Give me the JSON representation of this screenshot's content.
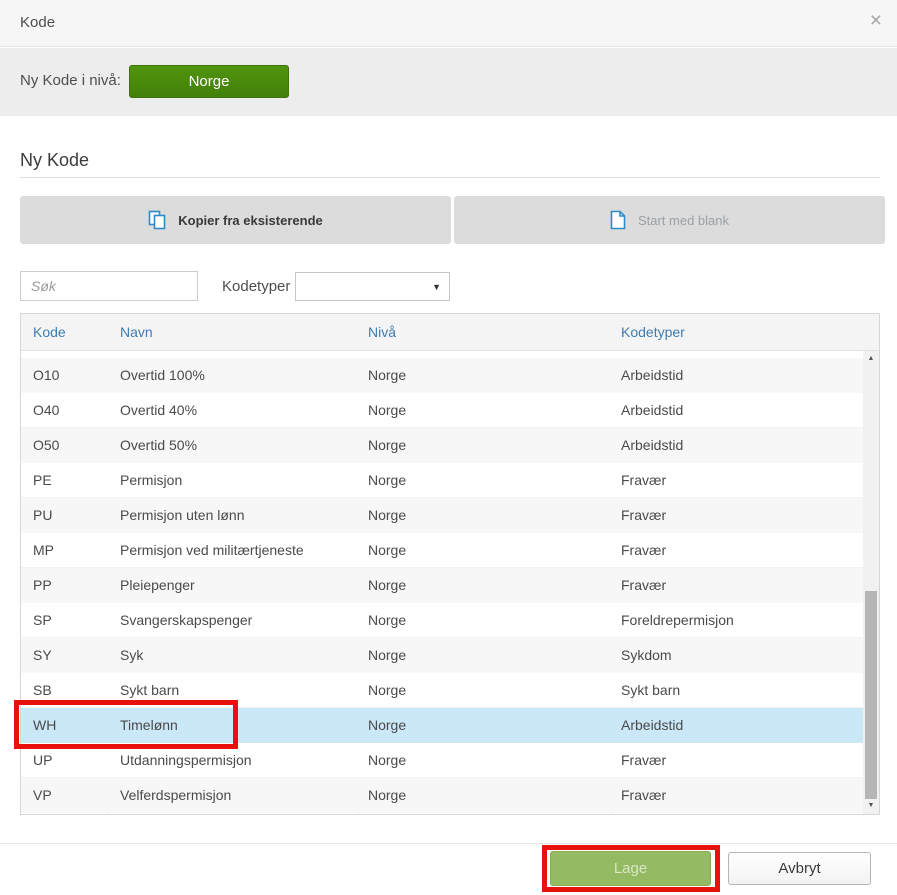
{
  "dialog": {
    "title": "Kode"
  },
  "icons": {
    "close": "×",
    "dropdown_arrow": "▼",
    "scroll_up": "▲",
    "scroll_down": "▼"
  },
  "level_bar": {
    "label": "Ny Kode i nivå:",
    "button_label": "Norge"
  },
  "section_heading": "Ny Kode",
  "tabs": [
    {
      "label": "Kopier fra eksisterende",
      "state": "active",
      "icon": "copy-icon"
    },
    {
      "label": "Start med blank",
      "state": "disabled",
      "icon": "blank-page-icon"
    }
  ],
  "filters": {
    "search_placeholder": "Søk",
    "search_value": "",
    "kodetyper_label": "Kodetyper",
    "kodetyper_selected_value": ""
  },
  "table": {
    "columns": [
      "Kode",
      "Navn",
      "Nivå",
      "Kodetyper"
    ],
    "rows": [
      [
        "O10",
        "Overtid 100%",
        "Norge",
        "Arbeidstid"
      ],
      [
        "O40",
        "Overtid 40%",
        "Norge",
        "Arbeidstid"
      ],
      [
        "O50",
        "Overtid 50%",
        "Norge",
        "Arbeidstid"
      ],
      [
        "PE",
        "Permisjon",
        "Norge",
        "Fravær"
      ],
      [
        "PU",
        "Permisjon uten lønn",
        "Norge",
        "Fravær"
      ],
      [
        "MP",
        "Permisjon ved militærtjeneste",
        "Norge",
        "Fravær"
      ],
      [
        "PP",
        "Pleiepenger",
        "Norge",
        "Fravær"
      ],
      [
        "SP",
        "Svangerskapspenger",
        "Norge",
        "Foreldrepermisjon"
      ],
      [
        "SY",
        "Syk",
        "Norge",
        "Sykdom"
      ],
      [
        "SB",
        "Sykt barn",
        "Norge",
        "Sykt barn"
      ],
      [
        "WH",
        "Timelønn",
        "Norge",
        "Arbeidstid"
      ],
      [
        "UP",
        "Utdanningspermisjon",
        "Norge",
        "Fravær"
      ],
      [
        "VP",
        "Velferdspermisjon",
        "Norge",
        "Fravær"
      ]
    ],
    "selected_index": 10,
    "selected_kode": "WH"
  },
  "footer": {
    "create_label": "Lage",
    "cancel_label": "Avbryt"
  },
  "colors": {
    "accent_green": "#4a8c0e",
    "disabled_green": "#95ba64",
    "selected_row_blue": "#cbe8f9",
    "table_header_blue": "#3e7cb1",
    "tab_gray": "#dcdcdc",
    "annotation_red": "#e8120c",
    "icon_blue": "#2e8bc9"
  }
}
